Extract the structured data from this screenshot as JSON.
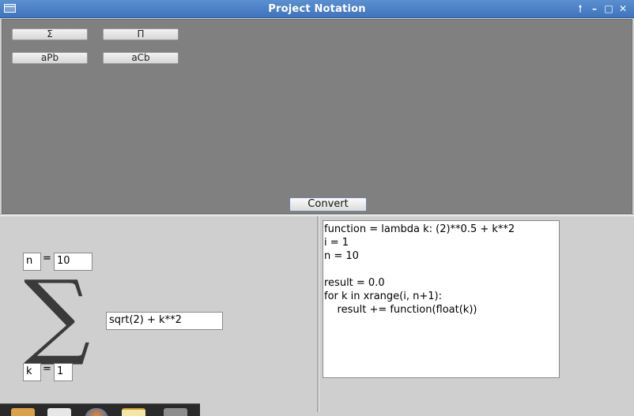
{
  "window": {
    "title": "Project Notation"
  },
  "titlebar_icons": [
    "menu-icon",
    "maximize-arrow-icon",
    "minimize-icon",
    "restore-icon",
    "close-icon"
  ],
  "titlebar_glyphs": {
    "up": "🠑",
    "min": "–",
    "max": "□",
    "close": "✕"
  },
  "toolbar": {
    "buttons": [
      "Σ",
      "Π",
      "aPb",
      "aCb"
    ]
  },
  "convert_label": "Convert",
  "summation": {
    "upper_var": "n",
    "upper_eq": "=",
    "upper_value": "10",
    "symbol": "∑",
    "expression": "sqrt(2) + k**2",
    "lower_var": "k",
    "lower_eq": "=",
    "lower_value": "1"
  },
  "code_output": "function = lambda k: (2)**0.5 + k**2\ni = 1\nn = 10\n\nresult = 0.0\nfor k in xrange(i, n+1):\n    result += function(float(k))",
  "taskbar": {
    "icons": [
      "app-icon",
      "files-icon",
      "firefox-icon",
      "notes-icon",
      "folder-icon"
    ]
  }
}
